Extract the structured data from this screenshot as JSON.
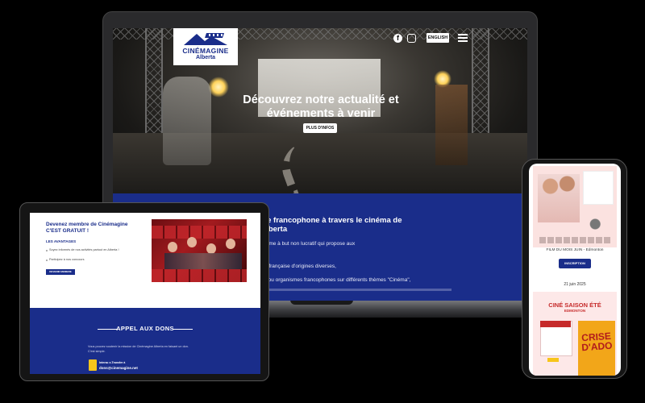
{
  "laptop": {
    "logo": {
      "name": "CINÉMAGINE",
      "sub": "Alberta"
    },
    "icons": {
      "facebook": "facebook-icon",
      "instagram": "instagram-icon",
      "menu": "hamburger-menu-icon"
    },
    "english_label": "ENGLISH",
    "hero": {
      "title_line1": "Découvrez notre actualité et",
      "title_line2": "événements à venir",
      "button_label": "PLUS D'INFOS"
    },
    "section": {
      "title_line1": "ulture francophone à travers le cinéma de",
      "title_line2": "en Alberta",
      "line1": "organisme à but non lucratif qui propose aux",
      "line2": "langue française d'origines diverses,",
      "line3": "écoles ou organismes francophones sur différents thèmes \"Cinéma\","
    }
  },
  "tablet": {
    "member_title_line1": "Devenez membre de Cinémagine",
    "member_title_line2": "C'EST GRATUIT !",
    "advantages_label": "LES AVANTAGES",
    "advantages": [
      "Soyez informés de nos activités partout en Alberta !",
      "Participez à nos concours"
    ],
    "member_button": "DEVENIR MEMBRE",
    "dons_title": "APPEL AUX DONS",
    "dons_text_line1": "Vous pouvez soutenir la mission de Cinémagine Alberta en faisant un don.",
    "dons_text_line2": "C'est simple.",
    "interac_label": "Interac e-Transfer à",
    "email": "dons@cinemagine.net"
  },
  "phone": {
    "film_caption": "FILM DU MOIS JUIN - Edmonton",
    "inscription_button": "INSCRIPTION",
    "date": "21 juin 2025",
    "poster2_title": "CINÉ SAISON ÉTÉ",
    "poster2_city": "EDMONTON",
    "poster2_film_line1": "CRISE",
    "poster2_film_line2": "D'ADO"
  },
  "colors": {
    "brand_blue": "#1a2d8a",
    "accent_yellow": "#f7c51b"
  }
}
